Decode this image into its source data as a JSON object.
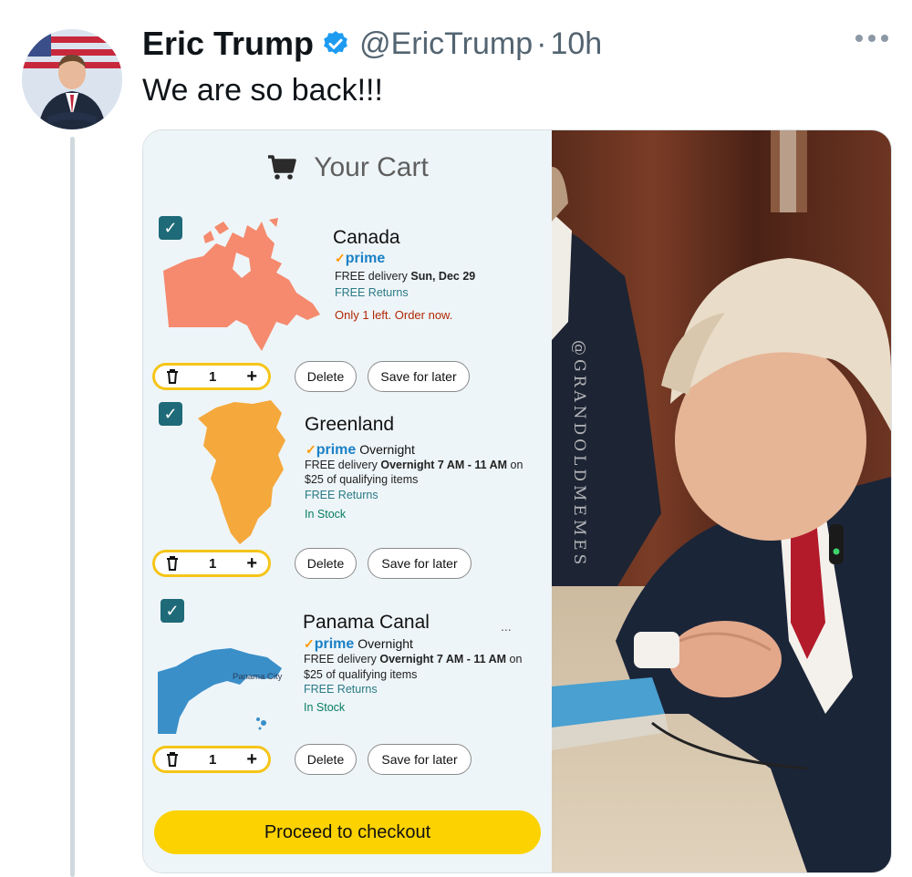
{
  "tweet": {
    "author_name": "Eric Trump",
    "handle": "@EricTrump",
    "separator": "·",
    "time": "10h",
    "text": "We are so back!!!",
    "verified_icon": "verified-badge-icon",
    "more_icon": "more-dots-icon"
  },
  "cart": {
    "title": "Your Cart",
    "cart_icon": "shopping-cart-icon",
    "items": [
      {
        "name": "Canada",
        "prime_label": "prime",
        "prime_suffix": "",
        "delivery_prefix": "FREE delivery ",
        "delivery_bold": "Sun, Dec 29",
        "delivery_suffix": "",
        "qualifying": "",
        "returns": "FREE Returns",
        "status": "Only 1 left. Order now.",
        "status_type": "low-stock",
        "quantity": "1",
        "delete_label": "Delete",
        "save_label": "Save for later",
        "map": "canada-map"
      },
      {
        "name": "Greenland",
        "prime_label": "prime",
        "prime_suffix": "Overnight",
        "delivery_prefix": "FREE delivery ",
        "delivery_bold": "Overnight 7 AM - 11 AM",
        "delivery_suffix": " on",
        "qualifying": "$25 of qualifying items",
        "returns": "FREE Returns",
        "status": "In Stock",
        "status_type": "in-stock",
        "quantity": "1",
        "delete_label": "Delete",
        "save_label": "Save for later",
        "map": "greenland-map"
      },
      {
        "name": "Panama Canal",
        "prime_label": "prime",
        "prime_suffix": "Overnight",
        "delivery_prefix": "FREE delivery ",
        "delivery_bold": "Overnight 7 AM - 11 AM",
        "delivery_suffix": " on",
        "qualifying": "$25 of qualifying items",
        "returns": "FREE Returns",
        "status": "In Stock",
        "status_type": "in-stock",
        "quantity": "1",
        "delete_label": "Delete",
        "save_label": "Save for later",
        "map": "panama-map",
        "map_label": "Panama City",
        "more_label": "..."
      }
    ],
    "checkout_label": "Proceed to checkout",
    "checkbox_mark": "✓",
    "trash_icon": "trash-icon",
    "plus_icon": "plus-icon"
  },
  "photo": {
    "watermark": "@GRANDOLDMEMES"
  },
  "colors": {
    "checkbox": "#1e6a78",
    "qty_border": "#f5c518",
    "checkout": "#fcd200",
    "prime_blue": "#1a80c6",
    "prime_check": "#ff9900",
    "canada_map": "#f58a6e",
    "greenland_map": "#f5a83c",
    "panama_map": "#3a8fc9"
  }
}
